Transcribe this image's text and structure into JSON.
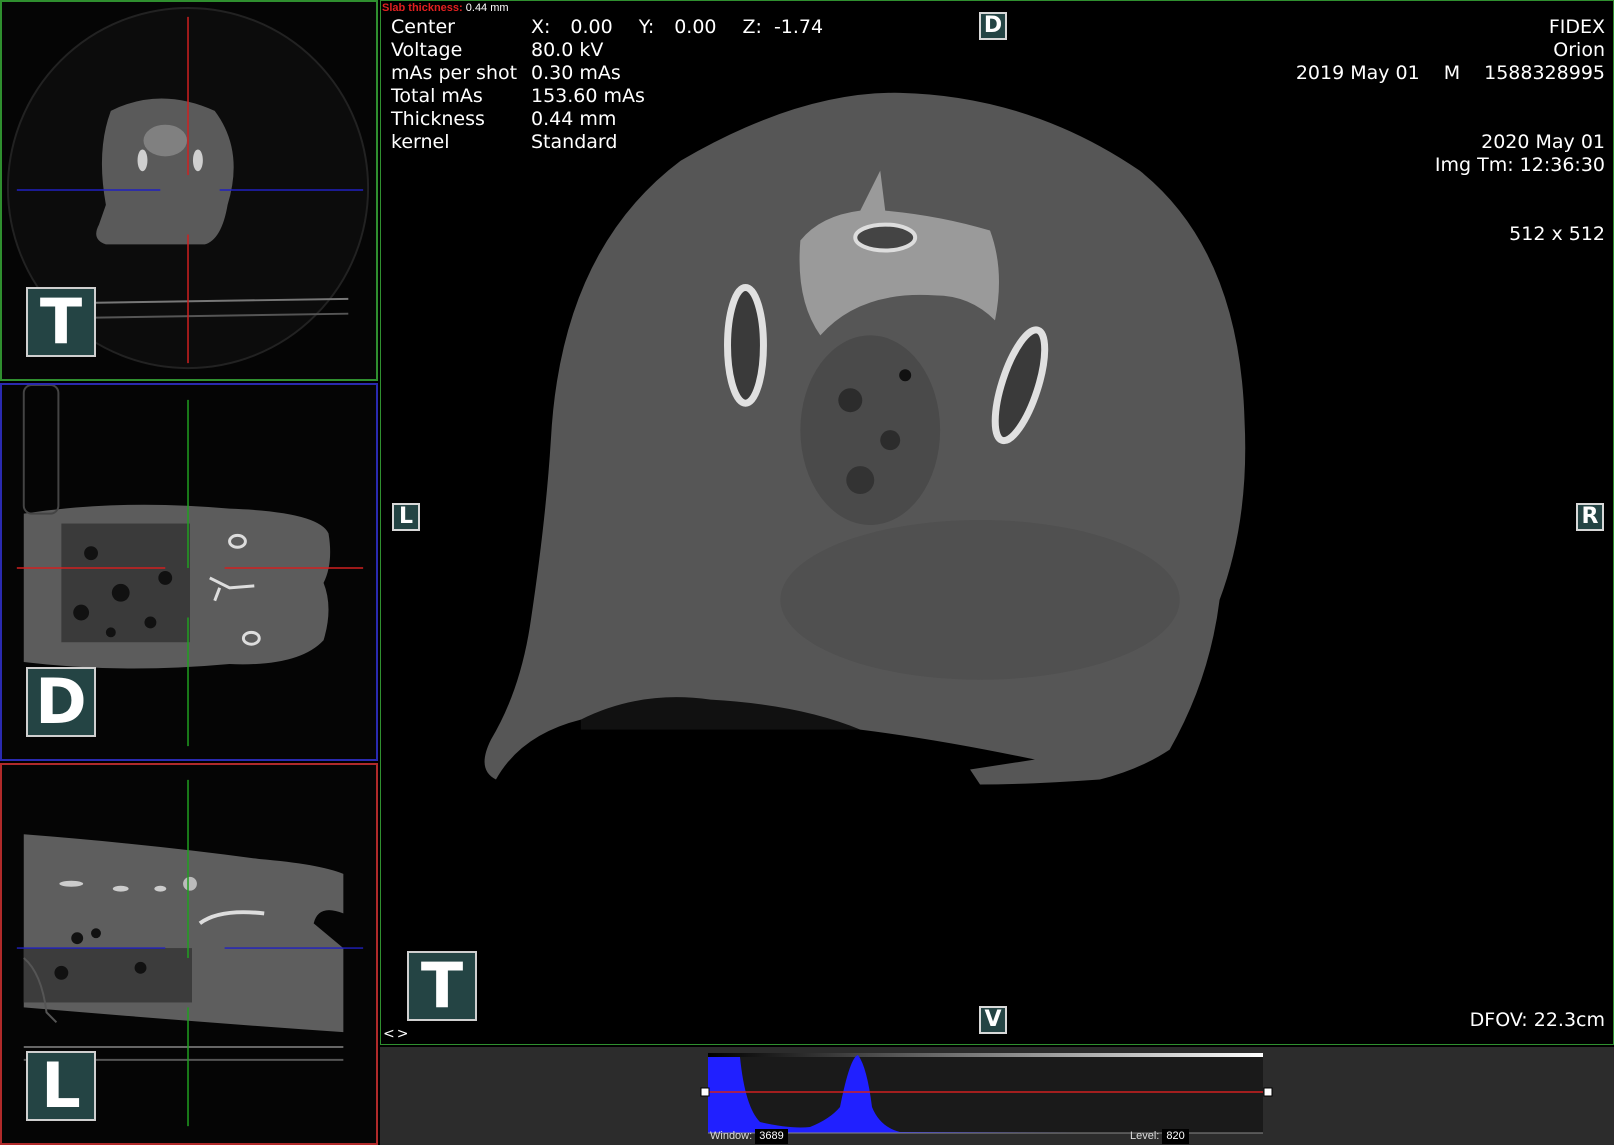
{
  "slab": {
    "label": "Slab thickness:",
    "value": "0.44 mm"
  },
  "info": {
    "center": {
      "label": "Center",
      "x_label": "X:",
      "x": "0.00",
      "y_label": "Y:",
      "y": "0.00",
      "z_label": "Z:",
      "z": "-1.74"
    },
    "rows": [
      {
        "key": "Voltage",
        "value": "80.0 kV"
      },
      {
        "key": "mAs per shot",
        "value": "0.30 mAs"
      },
      {
        "key": "Total mAs",
        "value": "153.60 mAs"
      },
      {
        "key": "Thickness",
        "value": "0.44 mm"
      },
      {
        "key": "kernel",
        "value": "Standard"
      }
    ]
  },
  "top_right": {
    "institution": "FIDEX",
    "patient": "Orion",
    "birth_date": "2019 May 01",
    "sex": "M",
    "patient_id": "1588328995",
    "study_date": "2020 May 01",
    "image_time": "Img Tm: 12:36:30",
    "matrix": "512 x 512"
  },
  "dfov": "DFOV: 22.3cm",
  "nav_arrows": "<>",
  "orientation": {
    "main_top": "D",
    "main_bottom": "V",
    "main_left": "L",
    "main_right": "R",
    "main_view": "T",
    "thumb_axial": "T",
    "thumb_coronal": "D",
    "thumb_sagital": "L"
  },
  "window_level": {
    "window_label": "Window:",
    "window_value": "3689",
    "level_label": "Level:",
    "level_value": "820"
  },
  "colors": {
    "axial_border": "#2f8f2f",
    "coronal_border": "#2a2ab0",
    "sagital_border": "#b02a2a",
    "histogram_fill": "#2020ff",
    "crosshair_red": "#d02020",
    "crosshair_blue": "#2020c0",
    "crosshair_green": "#20a020"
  }
}
